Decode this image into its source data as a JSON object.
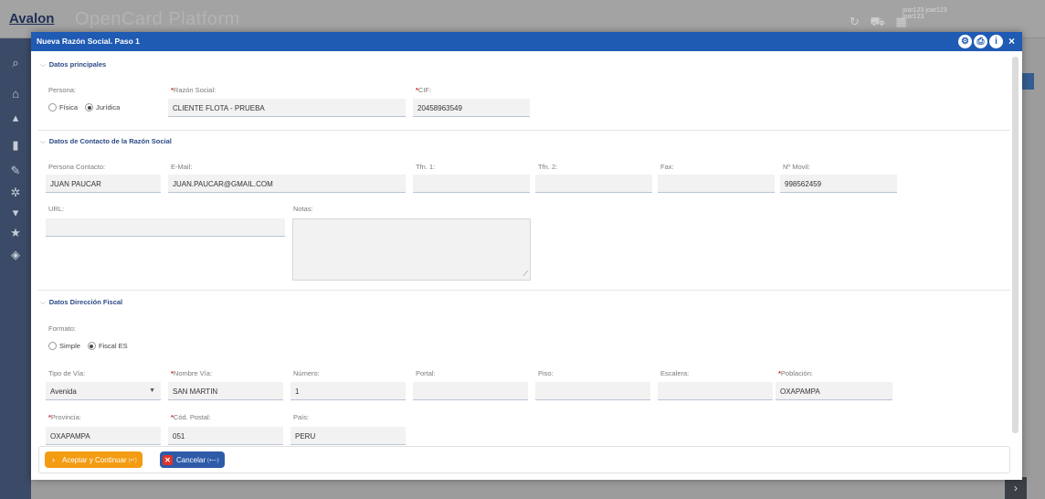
{
  "background": {
    "logo": "Avalon",
    "platform_name": "OpenCard Platform",
    "user_name": "joar123 joar123",
    "user_sub": "joar123"
  },
  "modal": {
    "title": "Nueva Razón Social. Paso 1",
    "header_icons": [
      "settings-icon",
      "print-icon",
      "info-icon",
      "close-icon"
    ]
  },
  "sections": {
    "principal": {
      "title": "Datos principales",
      "persona_label": "Persona:",
      "persona_options": [
        "Física",
        "Jurídica"
      ],
      "persona_selected": "Jurídica",
      "razon_social_label": "Razón Social:",
      "razon_social_value": "CLIENTE FLOTA - PRUEBA",
      "cif_label": "CIF:",
      "cif_value": "20458963549"
    },
    "contacto": {
      "title": "Datos de Contacto de la Razón Social",
      "persona_contacto_label": "Persona Contacto:",
      "persona_contacto_value": "JUAN PAUCAR",
      "email_label": "E-Mail:",
      "email_value": "JUAN.PAUCAR@GMAIL.COM",
      "tfn1_label": "Tfn. 1:",
      "tfn1_value": "",
      "tfn2_label": "Tfn. 2:",
      "tfn2_value": "",
      "fax_label": "Fax:",
      "fax_value": "",
      "movil_label": "Nº Movil:",
      "movil_value": "998562459",
      "url_label": "URL:",
      "url_value": "",
      "notas_label": "Notas:",
      "notas_value": ""
    },
    "direccion": {
      "title": "Datos Dirección Fiscal",
      "formato_label": "Formato:",
      "formato_options": [
        "Simple",
        "Fiscal ES"
      ],
      "formato_selected": "Fiscal ES",
      "tipo_via_label": "Tipo de Vía:",
      "tipo_via_value": "Avenida",
      "nombre_via_label": "Nombre Vía:",
      "nombre_via_value": "SAN MARTIN",
      "numero_label": "Número:",
      "numero_value": "1",
      "portal_label": "Portal:",
      "portal_value": "",
      "piso_label": "Piso:",
      "piso_value": "",
      "escalera_label": "Escalera:",
      "escalera_value": "",
      "poblacion_label": "Población:",
      "poblacion_value": "OXAPAMPA",
      "provincia_label": "Provincia:",
      "provincia_value": "OXAPAMPA",
      "cod_postal_label": "Cód. Postal:",
      "cod_postal_value": "051",
      "pais_label": "País:",
      "pais_value": "PERU"
    }
  },
  "footer": {
    "accept_label": "Aceptar y Continuar",
    "accept_shortcut": "(↵)",
    "cancel_label": "Cancelar",
    "cancel_shortcut": "(⟵)"
  },
  "colors": {
    "header": "#1f5ab3",
    "accept": "#f39c12",
    "cancel": "#2d5ba8",
    "required": "#d9232d"
  }
}
